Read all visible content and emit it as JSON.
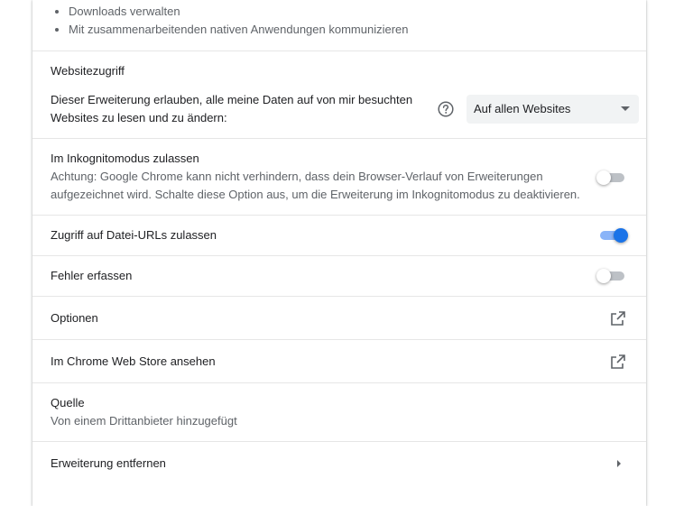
{
  "colors": {
    "text_primary": "#202124",
    "text_secondary": "#5f6368",
    "toggle_on": "#1a73e8",
    "divider": "#e6e6e6",
    "select_bg": "#f1f3f4"
  },
  "permissions": {
    "items": [
      "Downloads verwalten",
      "Mit zusammenarbeitenden nativen Anwendungen kommunizieren"
    ]
  },
  "site_access": {
    "heading": "Websitezugriff",
    "description_line1": "Dieser Erweiterung erlauben, alle meine Daten auf von mir besuchten",
    "description_line2": "Websites zu lesen und zu ändern:",
    "help_icon": "help-circle-icon",
    "select_value": "Auf allen Websites"
  },
  "incognito": {
    "label": "Im Inkognitomodus zulassen",
    "warning_line1": "Achtung: Google Chrome kann nicht verhindern, dass dein Browser-Verlauf von Erweiterungen",
    "warning_line2": "aufgezeichnet wird. Schalte diese Option aus, um die Erweiterung im Inkognitomodus zu deaktivieren.",
    "enabled": false
  },
  "file_urls": {
    "label": "Zugriff auf Datei-URLs zulassen",
    "enabled": true
  },
  "collect_errors": {
    "label": "Fehler erfassen",
    "enabled": false
  },
  "options": {
    "label": "Optionen",
    "icon": "open-in-new-icon"
  },
  "web_store": {
    "label": "Im Chrome Web Store ansehen",
    "icon": "open-in-new-icon"
  },
  "source": {
    "heading": "Quelle",
    "value": "Von einem Drittanbieter hinzugefügt"
  },
  "remove": {
    "label": "Erweiterung entfernen",
    "icon": "chevron-right-icon"
  }
}
